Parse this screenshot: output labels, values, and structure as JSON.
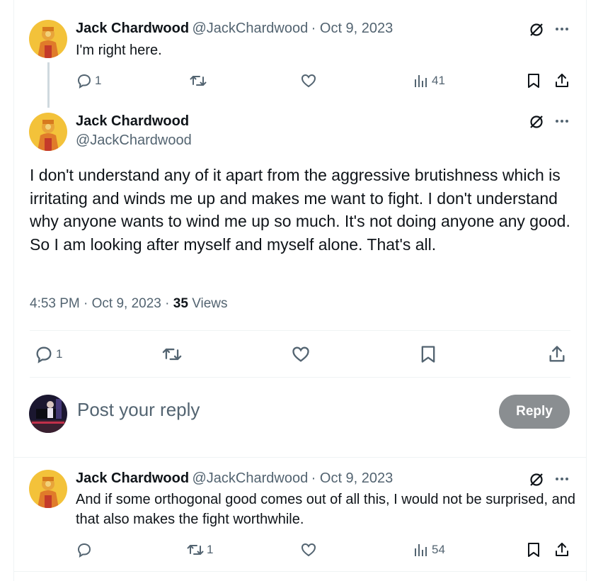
{
  "tweets": [
    {
      "name": "Jack Chardwood",
      "handle": "@JackChardwood",
      "date": "· Oct 9, 2023",
      "text": "I'm right here.",
      "replies": "1",
      "reposts": "",
      "views": "41"
    },
    {
      "name": "Jack Chardwood",
      "handle": "@JackChardwood",
      "date": "· Oct 9, 2023",
      "text": "And if some orthogonal good comes out of all this, I would not be surprised, and that also makes the fight worthwhile.",
      "replies": "",
      "reposts": "1",
      "views": "54"
    }
  ],
  "main": {
    "name": "Jack Chardwood",
    "handle": "@JackChardwood",
    "text": "I don't understand any of it apart from the aggressive brutishness which is irritating and winds me up and makes me want to fight. I don't understand why anyone wants to wind me up so much. It's not doing anyone any good. So I am looking after myself and myself alone. That's all.",
    "time": "4:53 PM · Oct 9, 2023 ·",
    "views_count": "35",
    "views_label": "Views",
    "replies": "1"
  },
  "reply_box": {
    "placeholder": "Post your reply",
    "button_label": "Reply"
  },
  "icons": [
    "verified-off-icon",
    "more-icon",
    "reply-icon",
    "repost-icon",
    "like-icon",
    "views-icon",
    "bookmark-icon",
    "share-icon"
  ],
  "colors": {
    "text": "#0f1419",
    "secondary": "#536471",
    "border": "#eff3f4",
    "reply_button_disabled": "#8a8e91"
  }
}
